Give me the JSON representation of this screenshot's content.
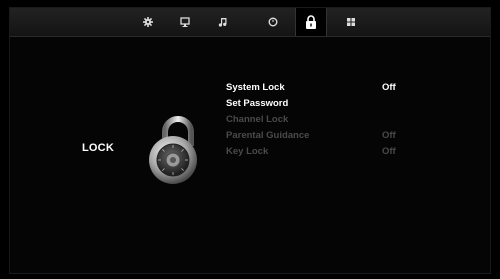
{
  "tabs": [
    {
      "icon": "gear-icon",
      "active": false
    },
    {
      "icon": "monitor-icon",
      "active": false
    },
    {
      "icon": "music-note-icon",
      "active": false
    },
    {
      "icon": "clock-icon",
      "active": false
    },
    {
      "icon": "padlock-icon",
      "active": true
    },
    {
      "icon": "grid-icon",
      "active": false
    }
  ],
  "page": {
    "title": "LOCK"
  },
  "menu": {
    "items": [
      {
        "label": "System Lock",
        "value": "Off",
        "enabled": true
      },
      {
        "label": "Set Password",
        "value": "",
        "enabled": true
      },
      {
        "label": "Channel Lock",
        "value": "",
        "enabled": false
      },
      {
        "label": "Parental Guidance",
        "value": "Off",
        "enabled": false
      },
      {
        "label": "Key Lock",
        "value": "Off",
        "enabled": false
      }
    ]
  },
  "colors": {
    "text": "#ffffff",
    "dim_text": "#4a4a4a",
    "background": "#000000",
    "topbar": "#1c1c1c"
  }
}
